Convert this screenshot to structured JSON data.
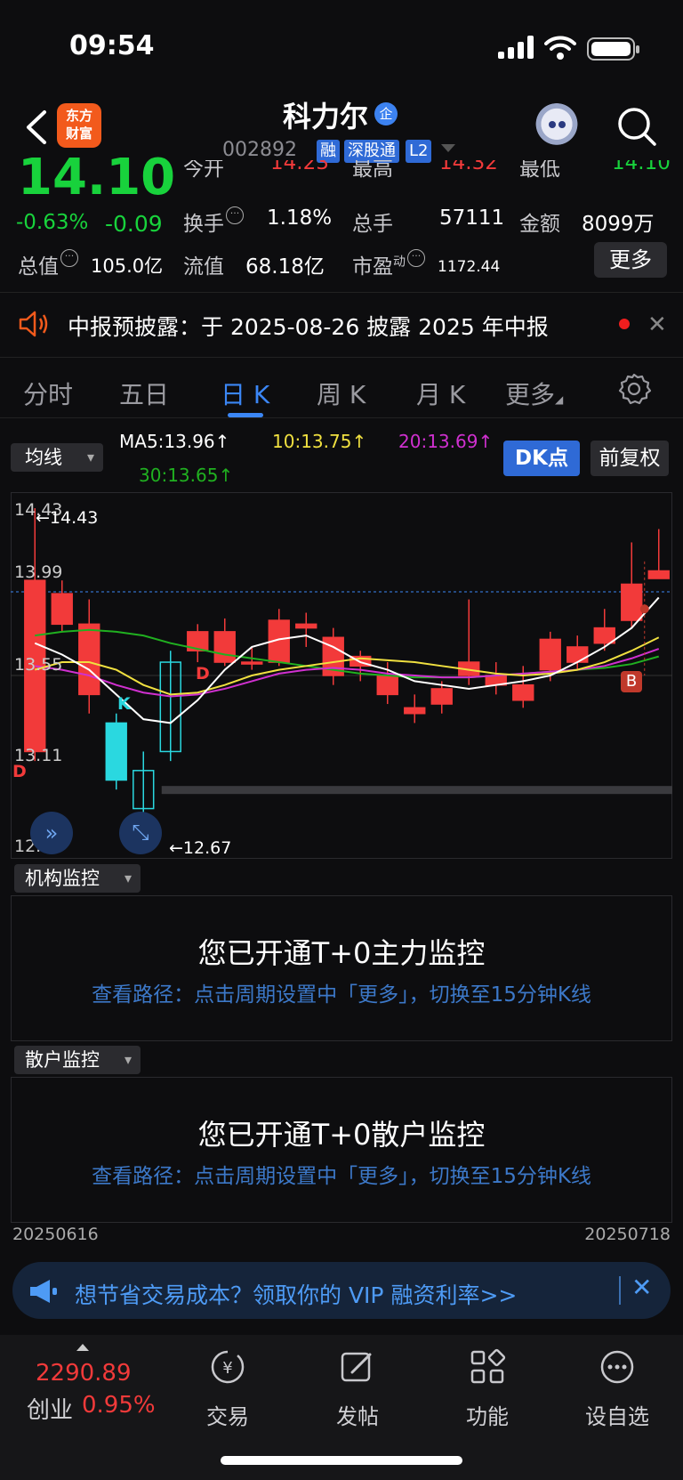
{
  "status": {
    "time": "09:54"
  },
  "header": {
    "logo_line1": "东方",
    "logo_line2": "财富",
    "name": "科力尔",
    "ent_badge": "企",
    "code": "002892",
    "tags": [
      "融",
      "深股通",
      "L2"
    ]
  },
  "quote": {
    "price": "14.10",
    "change_pct": "-0.63%",
    "change": "-0.09",
    "open_label": "今开",
    "open": "14.23",
    "high_label": "最高",
    "high": "14.32",
    "low_label": "最低",
    "low": "14.10",
    "turnover_label": "换手",
    "turnover": "1.18%",
    "volume_label": "总手",
    "volume": "57111",
    "amount_label": "金额",
    "amount": "8099万",
    "mktcap_label": "总值",
    "mktcap": "105.0亿",
    "float_label": "流值",
    "float_cap": "68.18亿",
    "pe_label": "市盈",
    "pe_sup": "动",
    "pe": "1172.44",
    "more": "更多"
  },
  "notice": {
    "text": "中报预披露：于 2025-08-26 披露 2025 年中报"
  },
  "tabs": [
    "分时",
    "五日",
    "日 K",
    "周 K",
    "月 K",
    "更多"
  ],
  "active_tab": "日 K",
  "ma_row": {
    "selector": "均线",
    "ma5": "MA5:13.96↑",
    "ma10": "10:13.75↑",
    "ma20": "20:13.69↑",
    "ma30": "30:13.65↑",
    "dk": "DK点",
    "fq": "前复权",
    "colors": {
      "ma5": "#ffffff",
      "ma10": "#f0e040",
      "ma20": "#d030d0",
      "ma30": "#20b020"
    }
  },
  "chart_data": {
    "type": "candlestick",
    "y_ticks": [
      "14.43",
      "13.99",
      "13.55",
      "13.11",
      "12.67"
    ],
    "ylim": [
      12.67,
      14.43
    ],
    "max_label": "←14.43",
    "min_label": "←12.67",
    "markers": [
      "D",
      "K",
      "D",
      "B"
    ],
    "start_date": "20250616",
    "end_date": "20250718",
    "candles": [
      {
        "o": 14.05,
        "c": 13.15,
        "h": 14.43,
        "l": 13.1
      },
      {
        "o": 13.98,
        "c": 13.82,
        "h": 14.05,
        "l": 13.78
      },
      {
        "o": 13.82,
        "c": 13.45,
        "h": 13.95,
        "l": 13.35
      },
      {
        "o": 13.3,
        "c": 13.0,
        "h": 13.35,
        "l": 12.95
      },
      {
        "o": 12.85,
        "c": 13.05,
        "h": 13.15,
        "l": 12.67
      },
      {
        "o": 13.15,
        "c": 13.62,
        "h": 13.68,
        "l": 13.1
      },
      {
        "o": 13.68,
        "c": 13.78,
        "h": 13.82,
        "l": 13.62
      },
      {
        "o": 13.78,
        "c": 13.62,
        "h": 13.85,
        "l": 13.6
      },
      {
        "o": 13.62,
        "c": 13.62,
        "h": 13.7,
        "l": 13.58
      },
      {
        "o": 13.62,
        "c": 13.84,
        "h": 13.9,
        "l": 13.6
      },
      {
        "o": 13.82,
        "c": 13.8,
        "h": 13.88,
        "l": 13.7
      },
      {
        "o": 13.75,
        "c": 13.55,
        "h": 13.8,
        "l": 13.5
      },
      {
        "o": 13.6,
        "c": 13.65,
        "h": 13.68,
        "l": 13.52
      },
      {
        "o": 13.55,
        "c": 13.45,
        "h": 13.62,
        "l": 13.4
      },
      {
        "o": 13.38,
        "c": 13.35,
        "h": 13.45,
        "l": 13.3
      },
      {
        "o": 13.4,
        "c": 13.48,
        "h": 13.52,
        "l": 13.35
      },
      {
        "o": 13.62,
        "c": 13.55,
        "h": 13.95,
        "l": 13.5
      },
      {
        "o": 13.55,
        "c": 13.5,
        "h": 13.62,
        "l": 13.45
      },
      {
        "o": 13.5,
        "c": 13.42,
        "h": 13.6,
        "l": 13.38
      },
      {
        "o": 13.58,
        "c": 13.74,
        "h": 13.78,
        "l": 13.52
      },
      {
        "o": 13.7,
        "c": 13.62,
        "h": 13.76,
        "l": 13.58
      },
      {
        "o": 13.72,
        "c": 13.8,
        "h": 13.9,
        "l": 13.68
      },
      {
        "o": 13.84,
        "c": 14.03,
        "h": 14.25,
        "l": 13.8
      },
      {
        "o": 14.06,
        "c": 14.1,
        "h": 14.32,
        "l": 14.06
      }
    ],
    "ma5": [
      13.72,
      13.66,
      13.58,
      13.45,
      13.32,
      13.3,
      13.42,
      13.58,
      13.7,
      13.74,
      13.76,
      13.7,
      13.62,
      13.58,
      13.52,
      13.5,
      13.48,
      13.5,
      13.52,
      13.55,
      13.62,
      13.7,
      13.8,
      13.96
    ],
    "ma10": [
      13.58,
      13.62,
      13.62,
      13.58,
      13.5,
      13.45,
      13.46,
      13.5,
      13.55,
      13.58,
      13.6,
      13.62,
      13.64,
      13.63,
      13.62,
      13.6,
      13.58,
      13.56,
      13.55,
      13.56,
      13.58,
      13.62,
      13.68,
      13.75
    ],
    "ma20": [
      13.6,
      13.58,
      13.55,
      13.5,
      13.46,
      13.44,
      13.45,
      13.48,
      13.52,
      13.56,
      13.58,
      13.59,
      13.58,
      13.56,
      13.55,
      13.54,
      13.54,
      13.55,
      13.56,
      13.57,
      13.58,
      13.6,
      13.64,
      13.69
    ],
    "ma30": [
      13.76,
      13.78,
      13.79,
      13.78,
      13.76,
      13.72,
      13.69,
      13.66,
      13.64,
      13.62,
      13.6,
      13.58,
      13.56,
      13.55,
      13.54,
      13.54,
      13.54,
      13.55,
      13.56,
      13.57,
      13.58,
      13.59,
      13.61,
      13.65
    ]
  },
  "monitor1": {
    "selector": "机构监控",
    "title": "您已开通T+0主力监控",
    "sub": "查看路径：点击周期设置中「更多」，切换至15分钟K线"
  },
  "monitor2": {
    "selector": "散户监控",
    "title": "您已开通T+0散户监控",
    "sub": "查看路径：点击周期设置中「更多」，切换至15分钟K线"
  },
  "promo": {
    "text": "想节省交易成本？领取你的 VIP 融资利率>>"
  },
  "bottom_nav": {
    "index_price": "2290.89",
    "index_name": "创业",
    "index_pct": "0.95%",
    "items": [
      {
        "label": "交易",
        "icon": "trade-icon"
      },
      {
        "label": "发帖",
        "icon": "post-icon"
      },
      {
        "label": "功能",
        "icon": "grid-icon"
      },
      {
        "label": "设自选",
        "icon": "more-dots-icon"
      }
    ]
  }
}
